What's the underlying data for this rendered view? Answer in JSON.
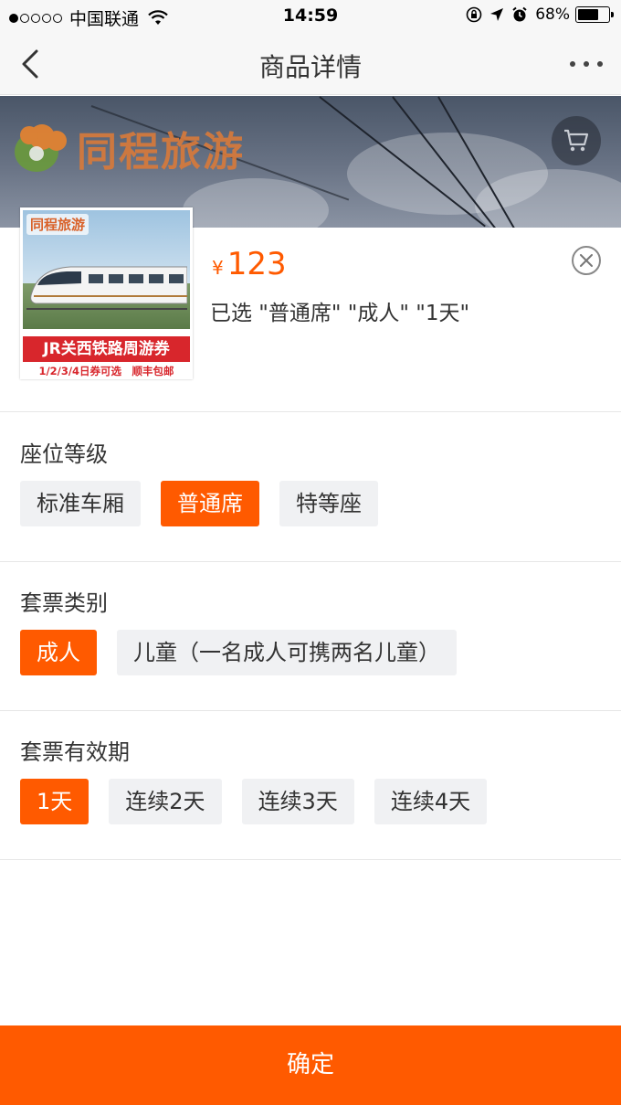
{
  "status_bar": {
    "carrier": "中国联通",
    "time": "14:59",
    "battery": "68%",
    "battery_level": 0.68
  },
  "nav": {
    "title": "商品详情"
  },
  "banner": {
    "logo_text": "同程旅游"
  },
  "product": {
    "thumb_logo": "同程旅游",
    "thumb_title": "JR关西铁路周游券",
    "thumb_subtitle": "1/2/3/4日券可选　顺丰包邮",
    "currency": "¥",
    "price": "123",
    "selected_text": "已选 \"普通席\" \"成人\" \"1天\""
  },
  "groups": [
    {
      "title": "座位等级",
      "options": [
        {
          "label": "标准车厢",
          "active": false
        },
        {
          "label": "普通席",
          "active": true
        },
        {
          "label": "特等座",
          "active": false
        }
      ]
    },
    {
      "title": "套票类别",
      "options": [
        {
          "label": "成人",
          "active": true
        },
        {
          "label": "儿童（一名成人可携两名儿童）",
          "active": false
        }
      ]
    },
    {
      "title": "套票有效期",
      "options": [
        {
          "label": "1天",
          "active": true
        },
        {
          "label": "连续2天",
          "active": false
        },
        {
          "label": "连续3天",
          "active": false
        },
        {
          "label": "连续4天",
          "active": false
        }
      ]
    }
  ],
  "confirm_label": "确定",
  "colors": {
    "accent": "#ff5a00",
    "option_bg": "#f0f1f3"
  }
}
